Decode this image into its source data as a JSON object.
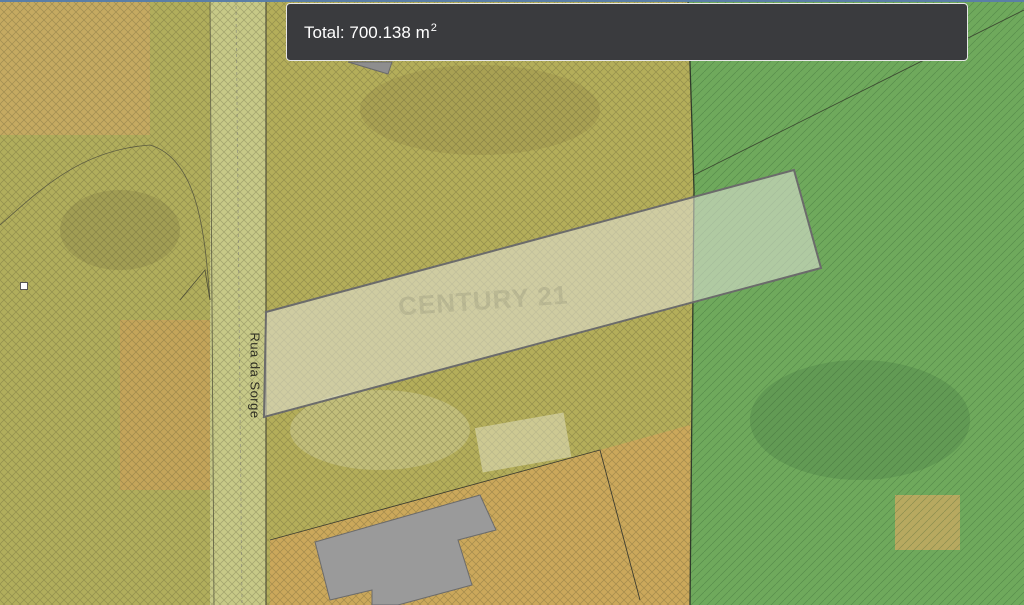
{
  "measurement": {
    "label": "Total:",
    "value": "700.138",
    "unit": "m",
    "unit_exponent": "2"
  },
  "map": {
    "street_label": "Rua da Sorge",
    "watermark_text": "CENTURY 21",
    "colors": {
      "zone_yellow": "#b7b65a",
      "zone_orange": "#d4a85c",
      "zone_green": "#6fae5f",
      "building_gray": "#9a9a9a",
      "parcel_fill": "#e6e6dc",
      "parcel_stroke": "#6b6b6b",
      "panel_background": "#3a3b3e"
    }
  }
}
